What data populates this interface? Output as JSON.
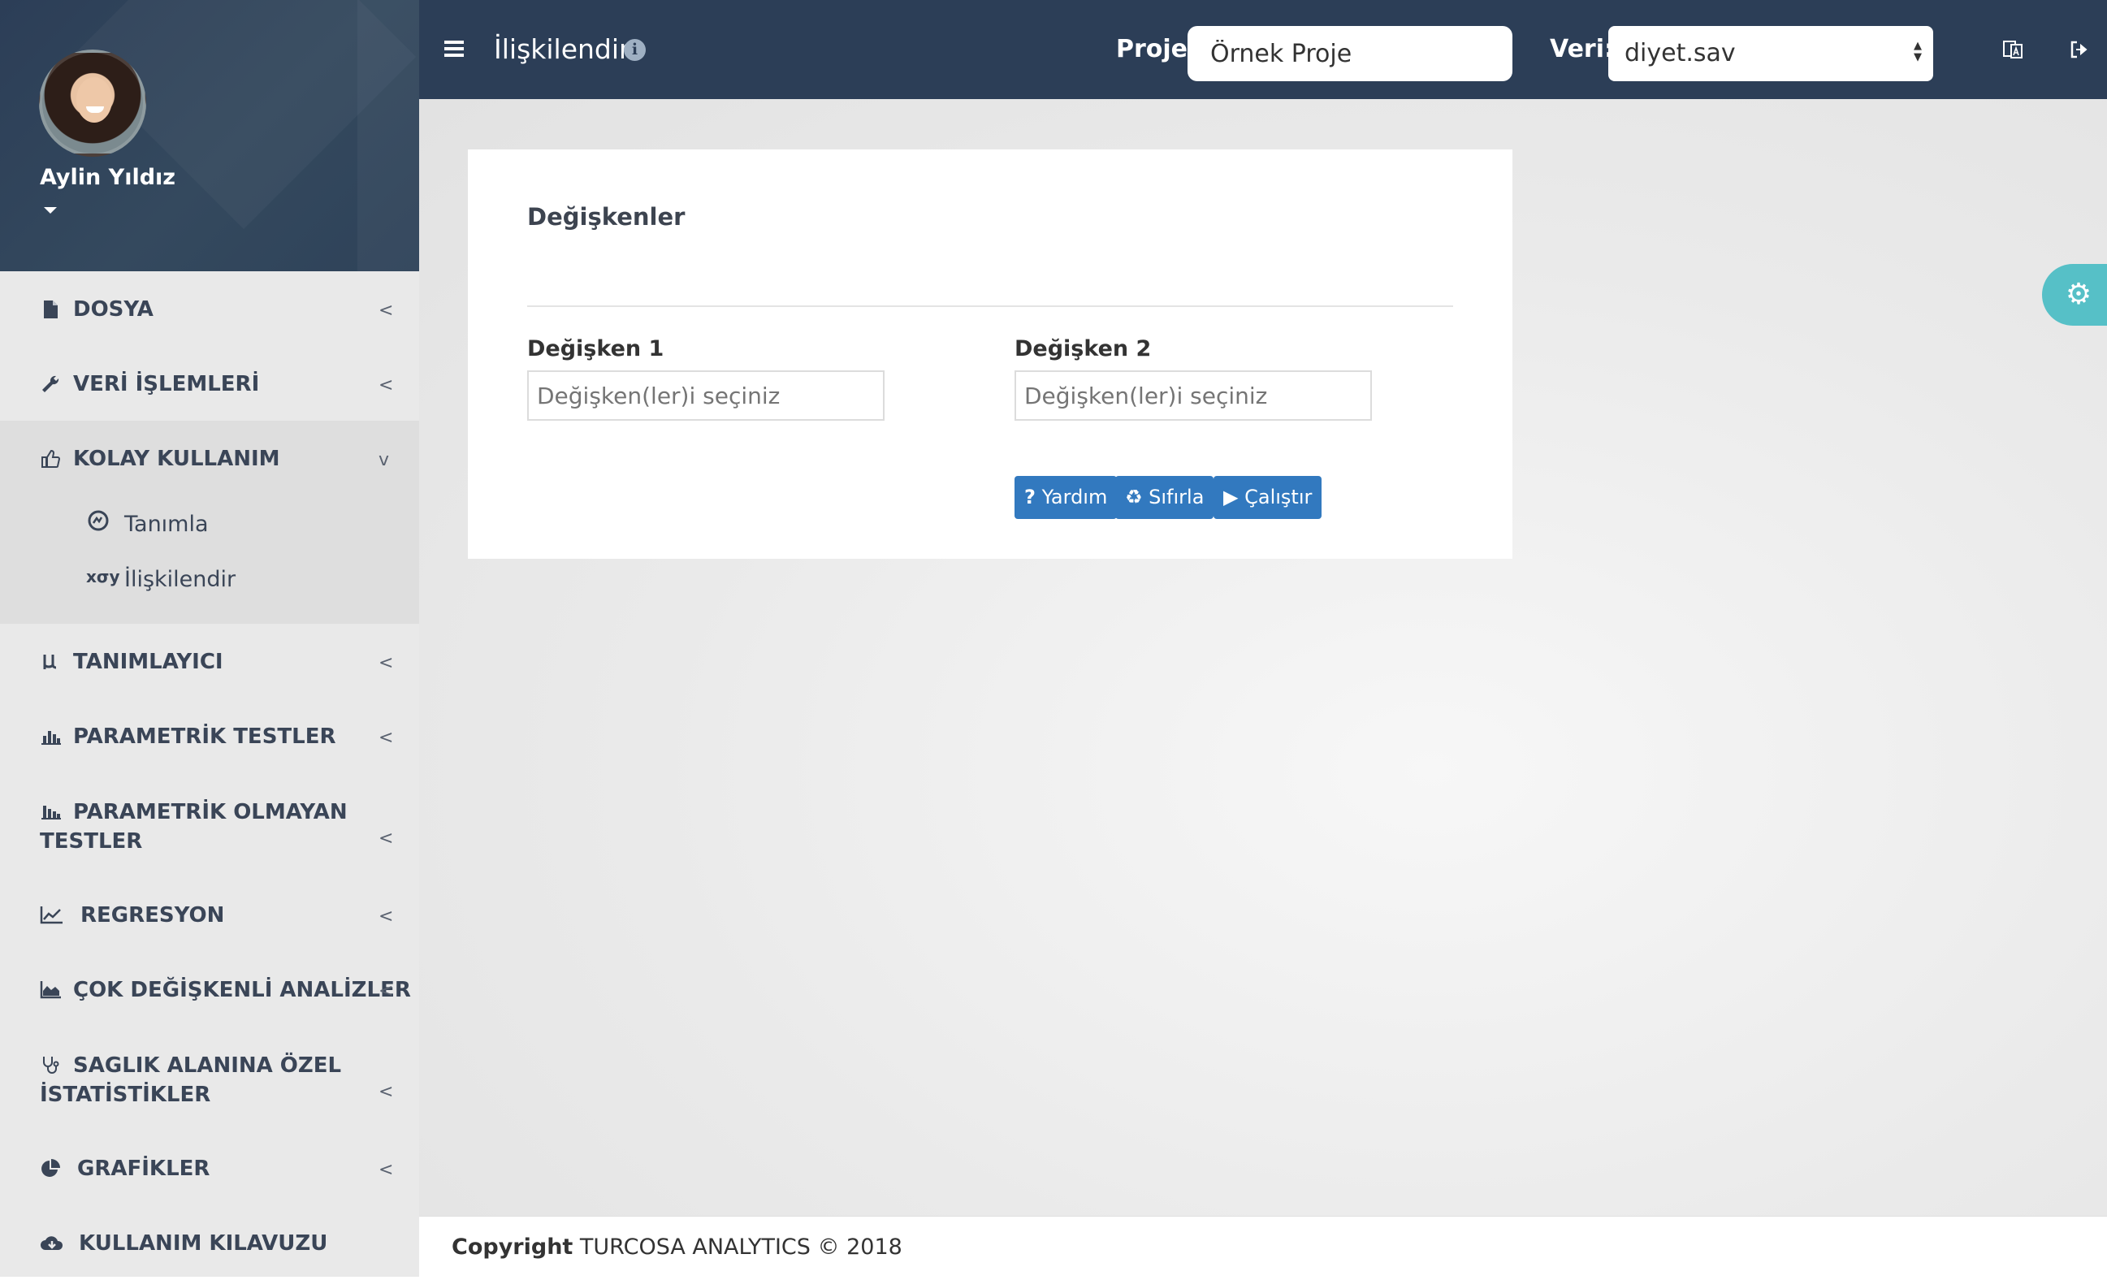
{
  "user": {
    "name": "Aylin Yıldız"
  },
  "sidebar": {
    "items": [
      {
        "label": "DOSYA",
        "icon": "file-icon"
      },
      {
        "label": "VERİ İŞLEMLERİ",
        "icon": "wrench-icon"
      },
      {
        "label": "KOLAY KULLANIM",
        "icon": "thumbs-up-icon",
        "expanded": true,
        "subitems": [
          {
            "label": "Tanımla",
            "icon": "describe-icon"
          },
          {
            "label": "İlişkilendir",
            "icon": "correlate-icon",
            "glyph": "xσy"
          }
        ]
      },
      {
        "label": "TANIMLAYICI",
        "icon": "mu-icon"
      },
      {
        "label": "PARAMETRİK TESTLER",
        "icon": "bar-chart-icon"
      },
      {
        "label": "PARAMETRİK OLMAYAN TESTLER",
        "icon": "bar-chart-alt-icon"
      },
      {
        "label": "REGRESYON",
        "icon": "line-chart-icon"
      },
      {
        "label": "ÇOK DEĞİŞKENLİ ANALİZLER",
        "icon": "area-chart-icon"
      },
      {
        "label": "SAGLIK ALANINA ÖZEL İSTATİSTİKLER",
        "icon": "stethoscope-icon"
      },
      {
        "label": "GRAFİKLER",
        "icon": "pie-chart-icon"
      },
      {
        "label": "KULLANIM KILAVUZU",
        "icon": "cloud-download-icon"
      }
    ]
  },
  "header": {
    "title": "İlişkilendir",
    "project_label": "Proje:",
    "project_value": "Örnek Proje",
    "data_label": "Veri:",
    "data_value": "diyet.sav"
  },
  "panel": {
    "title": "Değişkenler",
    "var1_label": "Değişken 1",
    "var1_placeholder": "Değişken(ler)i seçiniz",
    "var2_label": "Değişken 2",
    "var2_placeholder": "Değişken(ler)i seçiniz",
    "buttons": {
      "help_mark": "?",
      "help": "Yardım",
      "reset": "Sıfırla",
      "run": "Çalıştır"
    }
  },
  "footer": {
    "copyright_bold": "Copyright",
    "copyright_rest": "TURCOSA ANALYTICS © 2018"
  },
  "colors": {
    "topbar": "#2c3e57",
    "button": "#3279bf",
    "gear_tab": "#56c0c7",
    "sidebar": "#e9e9e9"
  }
}
